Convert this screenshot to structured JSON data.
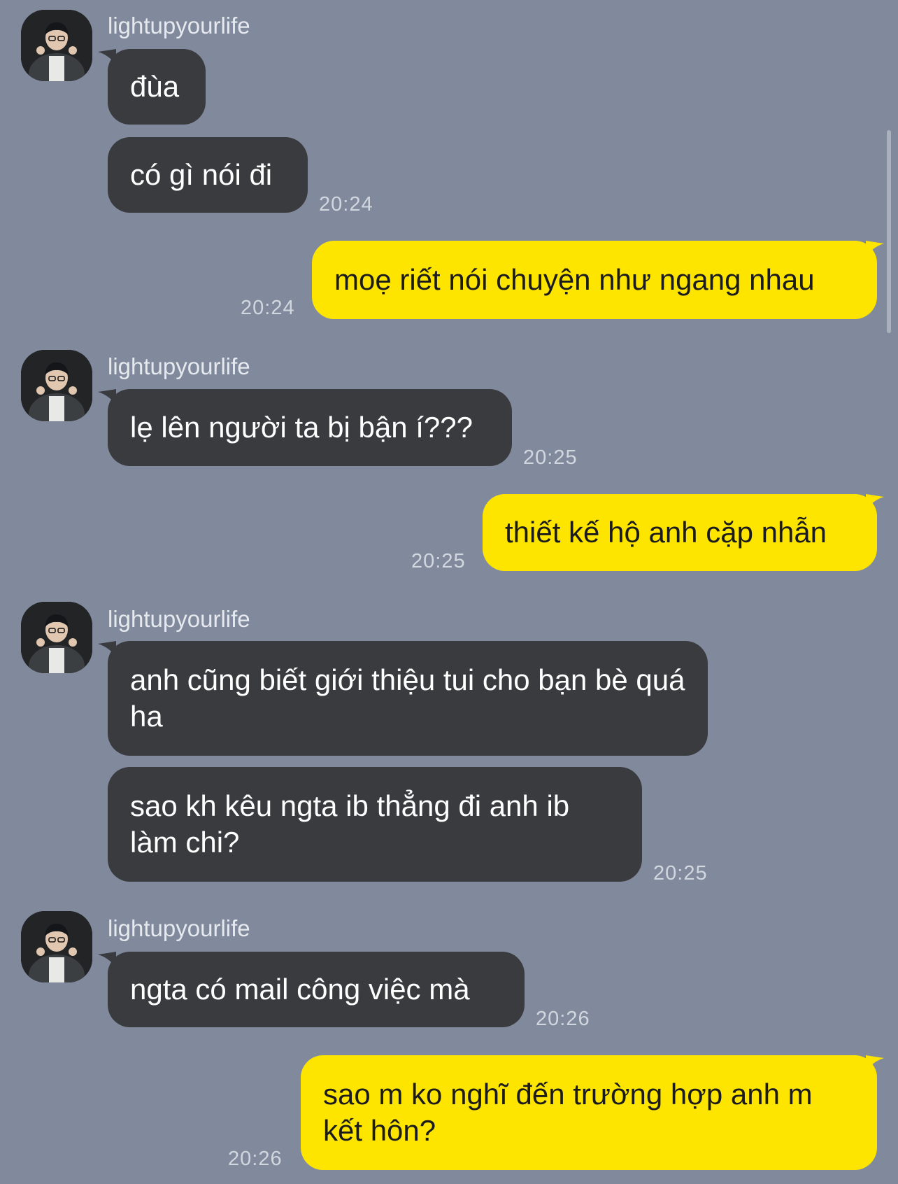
{
  "chat": {
    "sender_name": "lightupyourlife",
    "groups": [
      {
        "messages": [
          {
            "text": "đùa"
          },
          {
            "text": "có gì nói đi"
          }
        ],
        "time": "20:24"
      },
      {
        "out": {
          "text": "moẹ riết nói chuyện như ngang nhau",
          "time": "20:24"
        }
      },
      {
        "messages": [
          {
            "text": "lẹ lên người ta bị bận í???"
          }
        ],
        "time": "20:25"
      },
      {
        "out": {
          "text": "thiết kế hộ anh cặp nhẫn",
          "time": "20:25"
        }
      },
      {
        "messages": [
          {
            "text": "anh cũng biết giới thiệu tui cho bạn bè quá ha"
          },
          {
            "text": "sao kh kêu ngta ib thẳng đi anh ib làm chi?"
          }
        ],
        "time": "20:25"
      },
      {
        "messages": [
          {
            "text": "ngta có mail công việc mà"
          }
        ],
        "time": "20:26"
      },
      {
        "out": {
          "text": "sao m ko nghĩ đến trường hợp anh m kết hôn?",
          "time": "20:26"
        }
      }
    ]
  },
  "colors": {
    "background": "#808a9c",
    "incoming_bubble": "#3a3b3e",
    "outgoing_bubble": "#fee500"
  }
}
